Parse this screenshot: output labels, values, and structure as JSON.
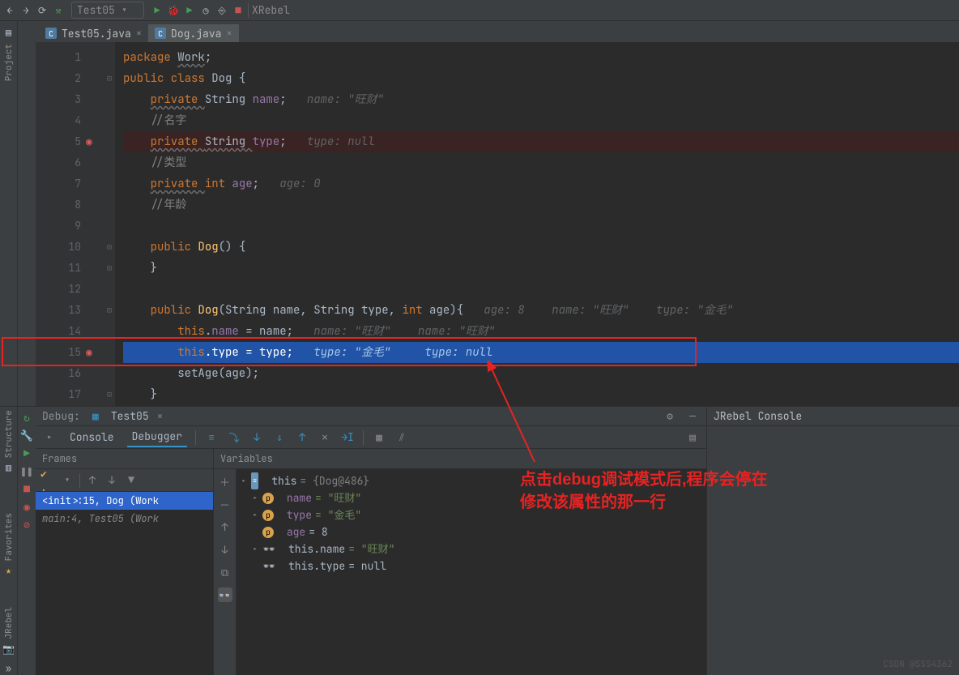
{
  "tabs": [
    {
      "name": "Test05.java",
      "active": false
    },
    {
      "name": "Dog.java",
      "active": true
    }
  ],
  "leftToolWindows": [
    "Project"
  ],
  "gutter_lines": [
    "1",
    "2",
    "3",
    "4",
    "5",
    "6",
    "7",
    "8",
    "9",
    "10",
    "11",
    "12",
    "13",
    "14",
    "15",
    "16",
    "17"
  ],
  "breakpoints": {
    "5": true,
    "15": true
  },
  "current_line": 15,
  "code": {
    "l1_package": "package ",
    "l1_pkg": "Work",
    "l1_end": ";",
    "l2": "public class Dog {",
    "l3_priv": "private ",
    "l3_type": "String ",
    "l3_name": "name",
    "l3_end": ";",
    "l3_hint": "name: \"旺财\"",
    "l4": "//名字",
    "l5_priv": "private ",
    "l5_type": "String ",
    "l5_name": "type",
    "l5_end": ";",
    "l5_hint": "type: null",
    "l6": "//类型",
    "l7_priv": "private ",
    "l7_type": "int ",
    "l7_name": "age",
    "l7_end": ";",
    "l7_hint": "age: 0",
    "l8": "//年龄",
    "l10": "public Dog() {",
    "l11": "}",
    "l13": "public Dog(String name, String type, int age){",
    "l13_hint": "age: 8    name: \"旺财\"    type: \"金毛\"",
    "l14": "this.name = name;",
    "l14_hint": "name: \"旺财\"    name: \"旺财\"",
    "l15_a": "this",
    "l15_b": ".type = type;",
    "l15_hint": "type: \"金毛\"     type: null",
    "l16": "setAge(age);",
    "l17": "}"
  },
  "debug": {
    "label": "Debug:",
    "run_name": "Test05",
    "console": "Console",
    "debugger": "Debugger",
    "frames_hdr": "Frames",
    "vars_hdr": "Variables",
    "frames": [
      {
        "text": "<init>:15, Dog (Work",
        "sel": true
      },
      {
        "text": "main:4, Test05 (Work",
        "sel": false
      }
    ],
    "vars": {
      "this_label": "this",
      "this_val": " = {Dog@486}",
      "name_label": "name",
      "name_val": " = \"旺财\"",
      "type_label": "type",
      "type_val": " = \"金毛\"",
      "age_label": "age",
      "age_val": " = 8",
      "thisname_label": "this.name",
      "thisname_val": " = \"旺财\"",
      "thistype_label": "this.type",
      "thistype_val": " = null"
    },
    "jrebel": "JRebel Console"
  },
  "annotation": {
    "line1": "点击debug调试模式后,程序会停在",
    "line2": "修改该属性的那一行"
  },
  "watermark": "CSDN @SSS4362",
  "bottomLeftTools": [
    "Structure",
    "Favorites",
    "JRebel"
  ],
  "toolbarTop": "XRebel"
}
